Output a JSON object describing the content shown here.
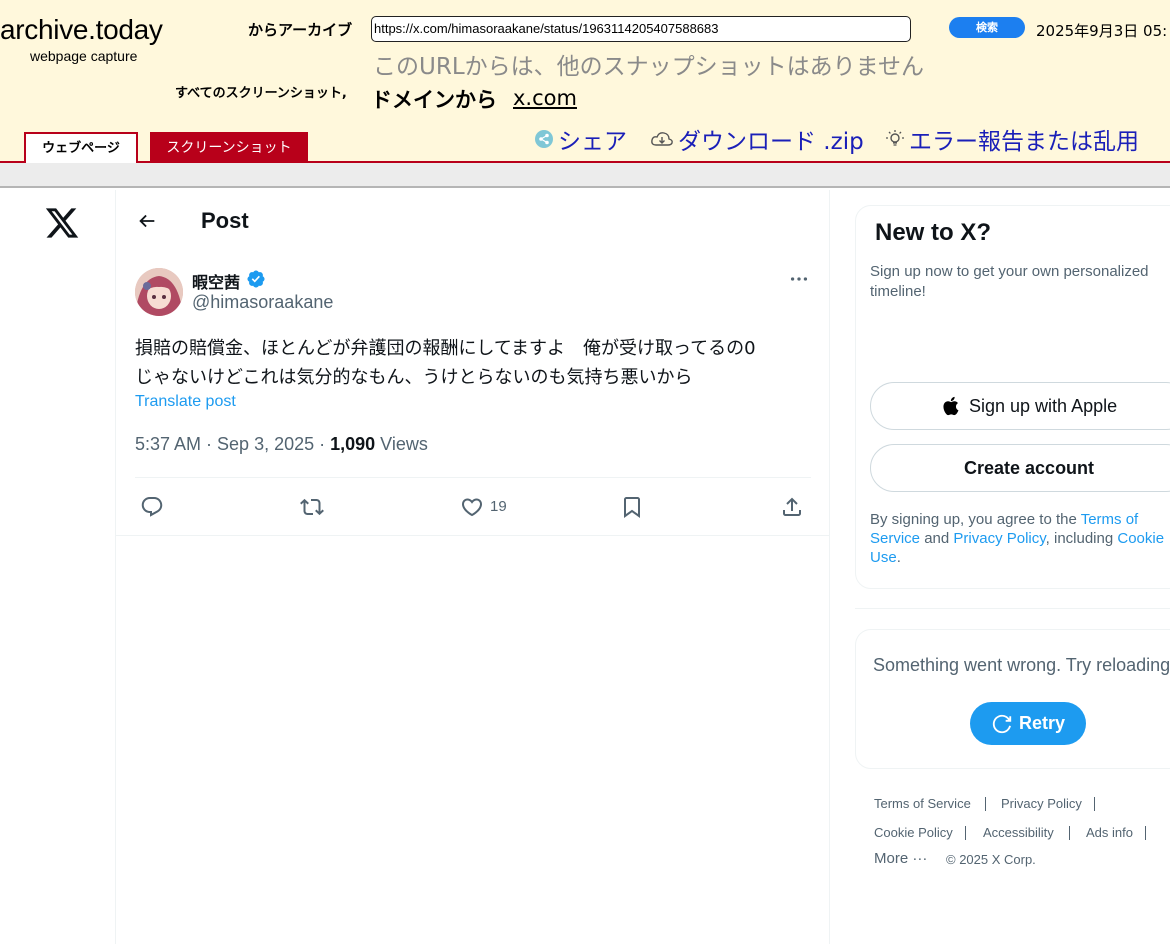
{
  "archive": {
    "logo": "archive.today",
    "subtitle": "webpage capture",
    "archive_from_label": "からアーカイブ",
    "url_value": "https://x.com/himasoraakane/status/1963114205407588683",
    "search_label": "検索",
    "date": "2025年9月3日 05:",
    "no_snapshots": "このURLからは、他のスナップショットはありません",
    "all_screenshots_label": "すべてのスクリーンショット,",
    "domain_prefix": "ドメインから",
    "domain_link": "x.com",
    "tab_webpage": "ウェブページ",
    "tab_screenshot": "スクリーンショット",
    "share": "シェア",
    "download": "ダウンロード .zip",
    "report": "エラー報告または乱用"
  },
  "post": {
    "header_title": "Post",
    "author_name": "暇空茜",
    "author_handle": "@himasoraakane",
    "text_line1": "損賠の賠償金、ほとんどが弁護団の報酬にしてますよ　俺が受け取ってるの0",
    "text_line2": "じゃないけどこれは気分的なもん、うけとらないのも気持ち悪いから",
    "translate": "Translate post",
    "meta_time": "5:37 AM · Sep 3, 2025 · ",
    "meta_views_count": "1,090",
    "meta_views_label": " Views",
    "like_count": "19"
  },
  "sidebar": {
    "title": "New to X?",
    "subtitle": "Sign up now to get your own personalized timeline!",
    "apple_button": "Sign up with Apple",
    "create_button": "Create account",
    "terms_pre": "By signing up, you agree to the ",
    "terms_link": "Terms of Service",
    "terms_mid": " and ",
    "privacy_link": "Privacy Policy",
    "terms_post": ", including ",
    "cookie_link": "Cookie Use",
    "terms_end": ".",
    "error_text": "Something went wrong. Try reloading.",
    "retry": "Retry"
  },
  "footer": {
    "terms": "Terms of Service",
    "privacy": "Privacy Policy",
    "cookie": "Cookie Policy",
    "accessibility": "Accessibility",
    "ads": "Ads info",
    "more": "More ···",
    "copyright": "© 2025 X Corp."
  },
  "colors": {
    "accent": "#1d9bf0",
    "archive_bg": "#fff8dc",
    "archive_red": "#b8001a",
    "archive_link": "#1a1fb8"
  }
}
